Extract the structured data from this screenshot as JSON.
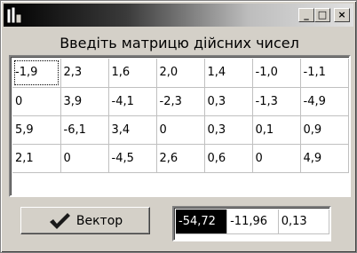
{
  "window": {
    "title": "",
    "icon": "app-icon",
    "buttons": {
      "minimize": "_",
      "maximize": "□",
      "close": "×"
    }
  },
  "heading": "Введіть матрицю дійсних чисел",
  "matrix": {
    "rows": [
      [
        "-1,9",
        "2,3",
        "1,6",
        "2,0",
        "1,4",
        "-1,0",
        "-1,1"
      ],
      [
        "0",
        "3,9",
        "-4,1",
        "-2,3",
        "0,3",
        "-1,3",
        "-4,9"
      ],
      [
        "5,9",
        "-6,1",
        "3,4",
        "0",
        "0,3",
        "0,1",
        "0,9"
      ],
      [
        "2,1",
        "0",
        "-4,5",
        "2,6",
        "0,6",
        "0",
        "4,9"
      ]
    ]
  },
  "vector_button": {
    "label": "Вектор",
    "icon": "check-icon",
    "icon_color": "#1a1a1a"
  },
  "vector": {
    "values": [
      "-54,72",
      "-11,96",
      "0,13"
    ]
  }
}
